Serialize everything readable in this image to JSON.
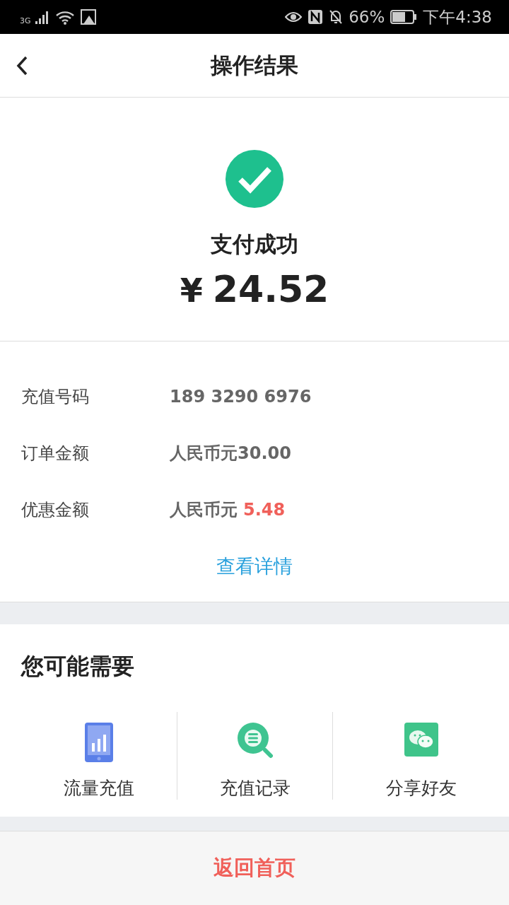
{
  "status_bar": {
    "network": "3G",
    "battery": "66%",
    "time": "下午4:38"
  },
  "header": {
    "title": "操作结果"
  },
  "result": {
    "status": "支付成功",
    "currency": "¥",
    "amount": "24.52"
  },
  "details": [
    {
      "label": "充值号码",
      "value": "189 3290 6976"
    },
    {
      "label": "订单金额",
      "value": "人民币元30.00"
    },
    {
      "label": "优惠金额",
      "value": "人民币元",
      "highlight": "5.48"
    }
  ],
  "details_link": "查看详情",
  "recommend": {
    "title": "您可能需要",
    "items": [
      {
        "kind": "phone",
        "label": "流量充值"
      },
      {
        "kind": "search",
        "label": "充值记录"
      },
      {
        "kind": "chat",
        "label": "分享好友"
      }
    ]
  },
  "footer_button": "返回首页"
}
